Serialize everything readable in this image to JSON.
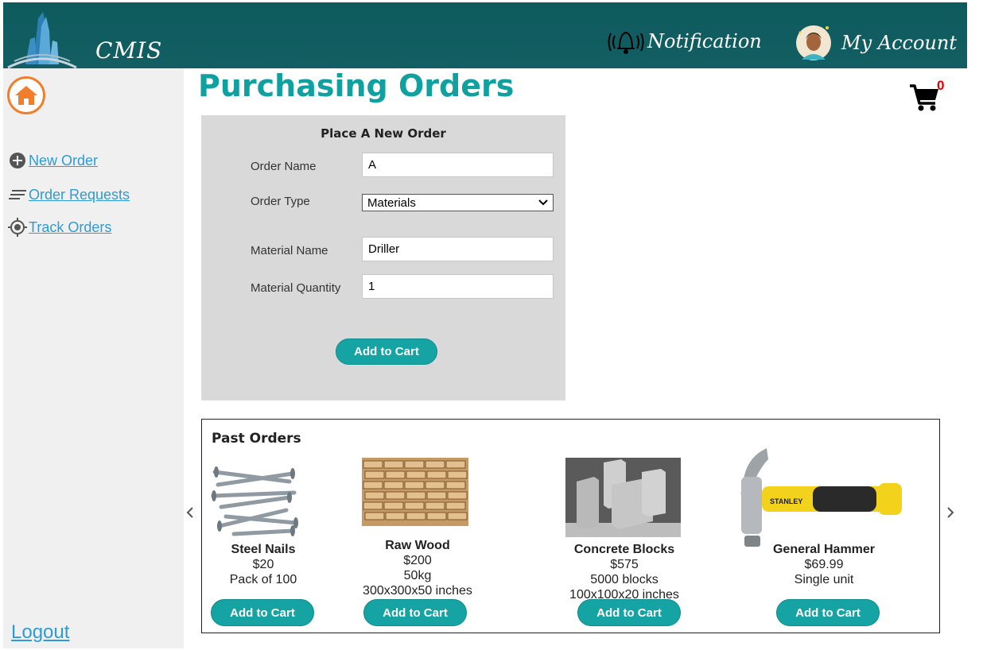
{
  "header": {
    "brand": "CMIS",
    "notification_label": "Notification",
    "account_label": "My Account",
    "bg_color": "#0e5b5e"
  },
  "sidebar": {
    "items": [
      {
        "label": "New Order",
        "icon": "plus-circle-icon"
      },
      {
        "label": "Order Requests",
        "icon": "lines-icon"
      },
      {
        "label": "Track Orders",
        "icon": "target-icon"
      }
    ],
    "logout_label": "Logout"
  },
  "main": {
    "title": "Purchasing Orders",
    "cart_count": "0",
    "form": {
      "title": "Place A New Order",
      "order_name_label": "Order Name",
      "order_name_value": "A",
      "order_type_label": "Order Type",
      "order_type_value": "Materials",
      "material_name_label": "Material Name",
      "material_name_value": "Driller",
      "material_quantity_label": "Material Quantity",
      "material_quantity_value": "1",
      "add_to_cart_label": "Add to Cart"
    },
    "past_orders": {
      "title": "Past Orders",
      "items": [
        {
          "name": "Steel Nails",
          "price": "$20",
          "detail1": "Pack of 100",
          "detail2": "",
          "button": "Add to Cart"
        },
        {
          "name": "Raw Wood",
          "price": "$200",
          "detail1": "50kg",
          "detail2": "300x300x50 inches",
          "button": "Add to Cart"
        },
        {
          "name": "Concrete Blocks",
          "price": "$575",
          "detail1": "5000 blocks",
          "detail2": "100x100x20 inches",
          "button": "Add to Cart"
        },
        {
          "name": "General Hammer",
          "price": "$69.99",
          "detail1": "Single unit",
          "detail2": "",
          "button": "Add to Cart"
        }
      ],
      "hammer_brand": "STANLEY"
    },
    "accent_color": "#16a3a3"
  }
}
